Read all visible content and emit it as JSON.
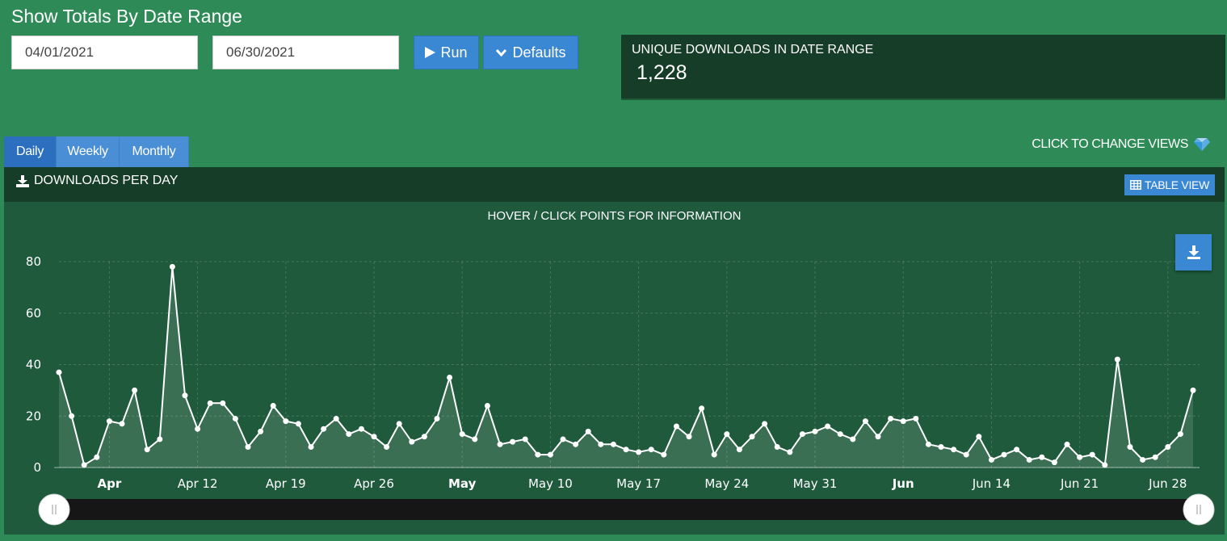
{
  "page": {
    "title": "Show Totals By Date Range",
    "start_date": "04/01/2021",
    "end_date": "06/30/2021",
    "run_label": "Run",
    "defaults_label": "Defaults"
  },
  "stat": {
    "label": "UNIQUE DOWNLOADS IN DATE RANGE",
    "value": "1,228"
  },
  "tabs": [
    {
      "label": "Daily",
      "active": true
    },
    {
      "label": "Weekly",
      "active": false
    },
    {
      "label": "Monthly",
      "active": false
    }
  ],
  "views_hint": "CLICK TO CHANGE VIEWS",
  "panel": {
    "title": "DOWNLOADS PER DAY",
    "table_view_label": "TABLE VIEW",
    "chart_hint": "HOVER / CLICK POINTS FOR INFORMATION"
  },
  "colors": {
    "background": "#2e8b57",
    "panel_dark": "#163d27",
    "chart_bg": "#1e5a3b",
    "accent_blue": "#3a87d3",
    "line": "#ffffff"
  },
  "icons": {
    "run": "play-icon",
    "defaults": "chevron-down-icon",
    "views": "diamond-icon",
    "panel": "download-icon",
    "table_view": "table-icon",
    "export": "download-icon"
  },
  "chart_data": {
    "type": "area",
    "title": "",
    "xlabel": "",
    "ylabel": "",
    "x_start": "2021-04-01",
    "x_end": "2021-06-30",
    "ylim": [
      0,
      80
    ],
    "yticks": [
      0,
      20,
      40,
      60,
      80
    ],
    "grid": true,
    "legend": "none",
    "x_ticks": [
      {
        "label": "Apr",
        "date": "2021-04-05",
        "bold": true
      },
      {
        "label": "Apr 12",
        "date": "2021-04-12",
        "bold": false
      },
      {
        "label": "Apr 19",
        "date": "2021-04-19",
        "bold": false
      },
      {
        "label": "Apr 26",
        "date": "2021-04-26",
        "bold": false
      },
      {
        "label": "May",
        "date": "2021-05-03",
        "bold": true
      },
      {
        "label": "May 10",
        "date": "2021-05-10",
        "bold": false
      },
      {
        "label": "May 17",
        "date": "2021-05-17",
        "bold": false
      },
      {
        "label": "May 24",
        "date": "2021-05-24",
        "bold": false
      },
      {
        "label": "May 31",
        "date": "2021-05-31",
        "bold": false
      },
      {
        "label": "Jun",
        "date": "2021-06-07",
        "bold": true
      },
      {
        "label": "Jun 14",
        "date": "2021-06-14",
        "bold": false
      },
      {
        "label": "Jun 21",
        "date": "2021-06-21",
        "bold": false
      },
      {
        "label": "Jun 28",
        "date": "2021-06-28",
        "bold": false
      }
    ],
    "values": [
      37,
      20,
      1,
      4,
      18,
      17,
      30,
      7,
      11,
      78,
      28,
      15,
      25,
      25,
      19,
      8,
      14,
      24,
      18,
      17,
      8,
      15,
      19,
      13,
      15,
      12,
      8,
      17,
      10,
      12,
      19,
      35,
      13,
      11,
      24,
      9,
      10,
      11,
      5,
      5,
      11,
      9,
      14,
      9,
      9,
      7,
      6,
      7,
      5,
      16,
      12,
      23,
      5,
      13,
      7,
      12,
      17,
      8,
      6,
      13,
      14,
      16,
      13,
      11,
      18,
      12,
      19,
      18,
      19,
      9,
      8,
      7,
      5,
      12,
      3,
      5,
      7,
      3,
      4,
      2,
      9,
      4,
      5,
      1,
      42,
      8,
      3,
      4,
      8,
      13,
      30
    ]
  }
}
